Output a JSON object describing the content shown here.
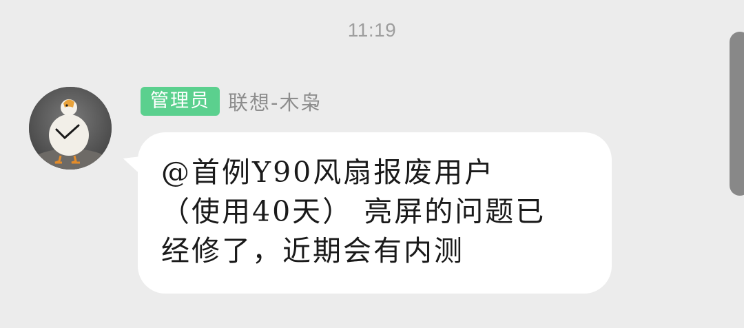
{
  "chat": {
    "timestamp": "11:19",
    "message": {
      "sender": {
        "role_badge": "管理员",
        "name": "联想-木枭"
      },
      "text_lines": [
        "@首例Y90风扇报废用户",
        "（使用40天） 亮屏的问题已",
        "经修了，近期会有内测"
      ]
    }
  },
  "colors": {
    "background": "#ececec",
    "bubble": "#ffffff",
    "role_badge": "#5bd08e",
    "sender_name": "#8d8d8d",
    "timestamp": "#9e9e9e",
    "scrollbar": "#888888"
  },
  "icons": {
    "avatar": "duck-avatar"
  }
}
